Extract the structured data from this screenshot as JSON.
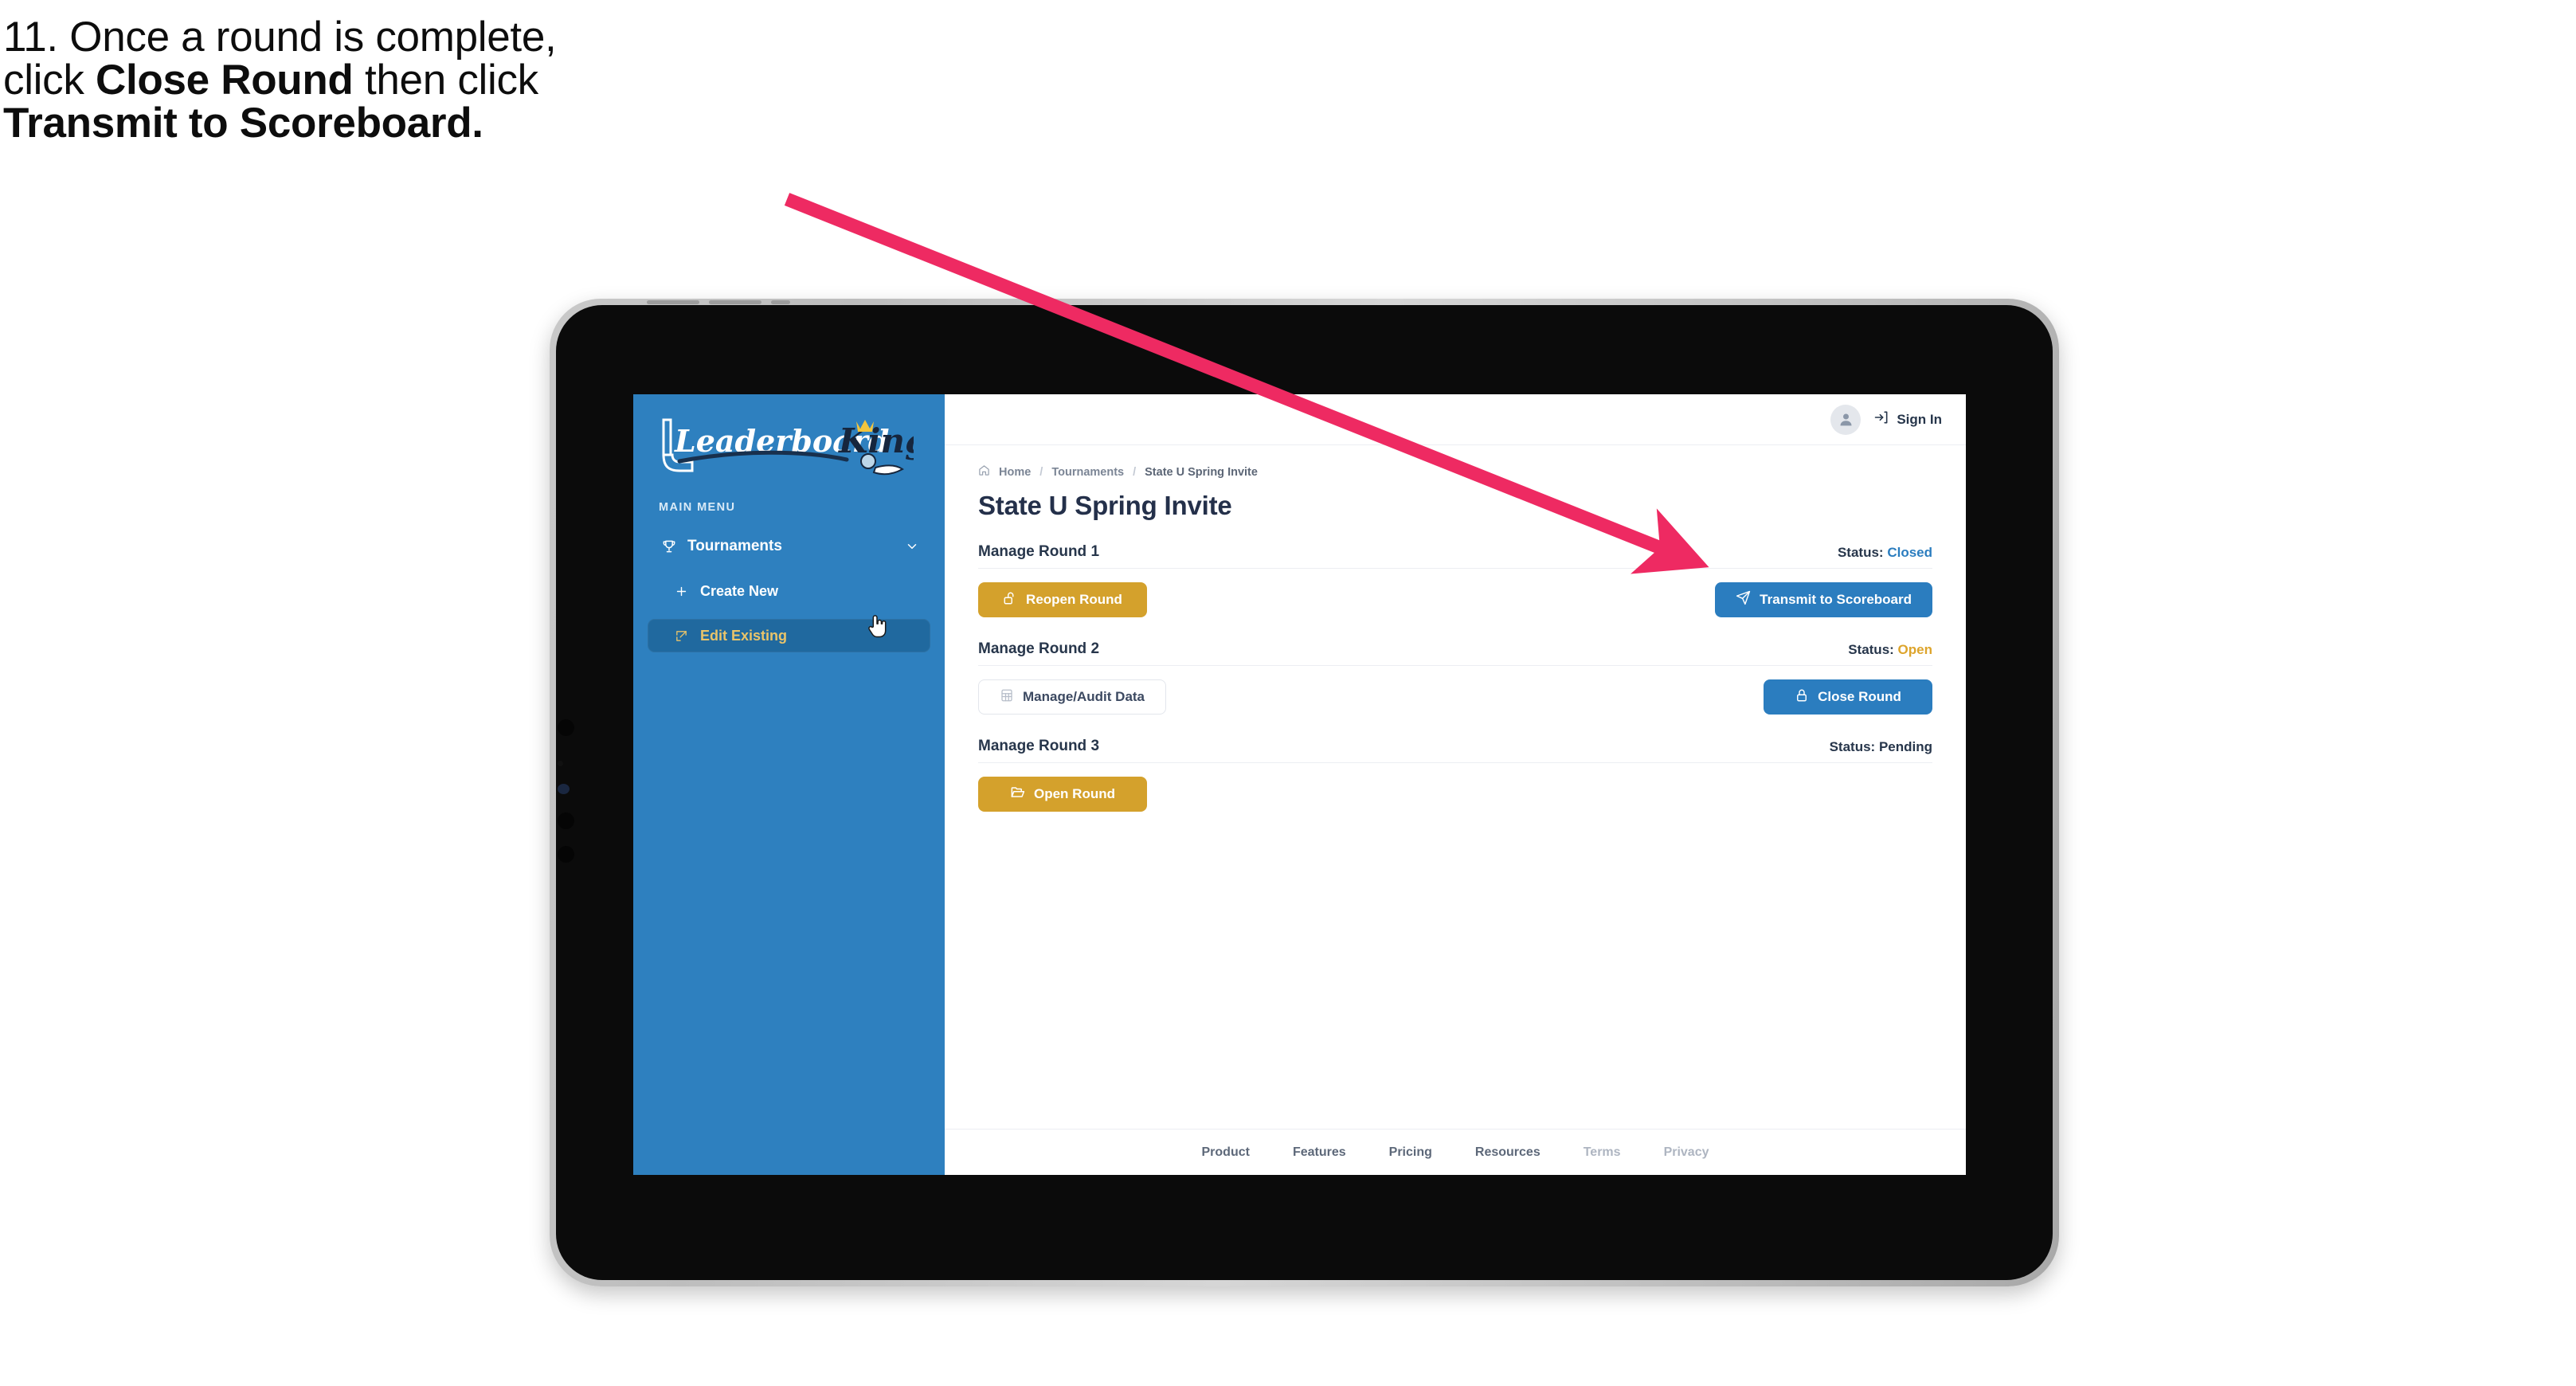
{
  "caption": {
    "line1": "11. Once a round is complete,",
    "line2_pre": "click ",
    "line2_bold": "Close Round",
    "line2_post": " then click",
    "line3_bold": "Transmit to Scoreboard."
  },
  "sidebar": {
    "logo_primary": "Leaderboard",
    "logo_secondary": "King",
    "menu_label": "MAIN MENU",
    "items": [
      {
        "label": "Tournaments",
        "icon": "trophy-icon"
      },
      {
        "label": "Create New",
        "icon": "plus-icon"
      },
      {
        "label": "Edit Existing",
        "icon": "edit-square-icon"
      }
    ]
  },
  "topbar": {
    "avatar_icon": "user-avatar-icon",
    "signin_icon": "sign-in-arrow-icon",
    "signin_label": "Sign In"
  },
  "breadcrumb": {
    "home_icon": "home-icon",
    "items": [
      "Home",
      "Tournaments",
      "State U Spring Invite"
    ],
    "separator": "/"
  },
  "page": {
    "title": "State U Spring Invite"
  },
  "rounds": [
    {
      "title": "Manage Round 1",
      "status_label": "Status:",
      "status_value": "Closed",
      "status_tone": "closed",
      "left_button": {
        "label": "Reopen Round",
        "icon": "unlock-icon",
        "style": "gold"
      },
      "right_button": {
        "label": "Transmit to Scoreboard",
        "icon": "paper-plane-icon",
        "style": "blue"
      }
    },
    {
      "title": "Manage Round 2",
      "status_label": "Status:",
      "status_value": "Open",
      "status_tone": "open",
      "left_button": {
        "label": "Manage/Audit Data",
        "icon": "table-grid-icon",
        "style": "ghost"
      },
      "right_button": {
        "label": "Close Round",
        "icon": "lock-icon",
        "style": "blue"
      }
    },
    {
      "title": "Manage Round 3",
      "status_label": "Status:",
      "status_value": "Pending",
      "status_tone": "pending",
      "left_button": {
        "label": "Open Round",
        "icon": "folder-open-icon",
        "style": "gold"
      },
      "right_button": null
    }
  ],
  "footer": {
    "links": [
      "Product",
      "Features",
      "Pricing",
      "Resources",
      "Terms",
      "Privacy"
    ]
  },
  "colors": {
    "sidebar_blue": "#2e80bf",
    "sidebar_active": "#20699f",
    "active_text_gold": "#e9c46a",
    "button_gold": "#d4a12c",
    "button_blue": "#2b7dbf",
    "status_closed": "#2b7dbf",
    "status_open": "#dda42b",
    "text_navy": "#27364b",
    "annotation_pink": "#ee2a62",
    "tablet_body": "#0b0b0b",
    "tablet_bezel": "#c9c9c9"
  },
  "annotation": {
    "arrow_color": "#ee2a62",
    "points_to": "Transmit to Scoreboard"
  },
  "cursor": {
    "type": "pointing-hand",
    "over": "Edit Existing"
  }
}
